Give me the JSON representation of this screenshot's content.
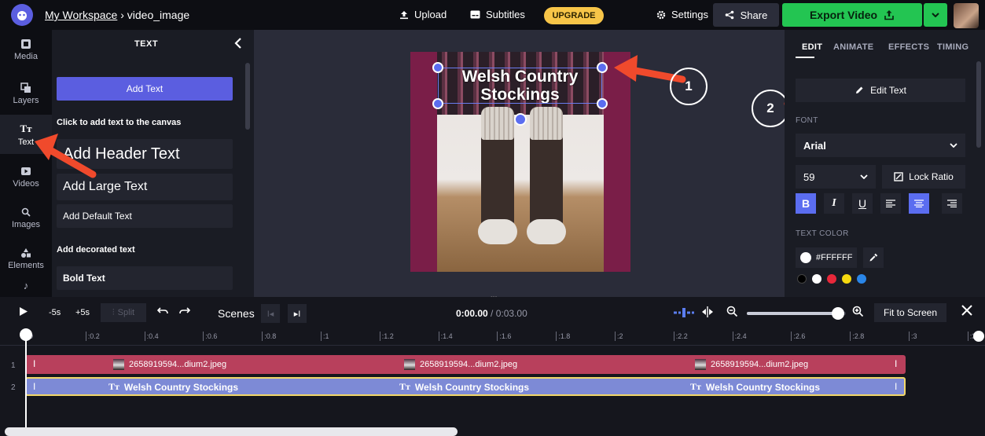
{
  "header": {
    "workspace": "My Workspace",
    "separator": "›",
    "project": "video_image",
    "upload": "Upload",
    "subtitles": "Subtitles",
    "upgrade": "UPGRADE",
    "settings": "Settings",
    "share": "Share",
    "export": "Export Video"
  },
  "nav": {
    "items": [
      {
        "label": "Media"
      },
      {
        "label": "Layers"
      },
      {
        "label": "Text"
      },
      {
        "label": "Videos"
      },
      {
        "label": "Images"
      },
      {
        "label": "Elements"
      }
    ]
  },
  "text_panel": {
    "title": "TEXT",
    "add_text": "Add Text",
    "hint": "Click to add text to the canvas",
    "header_text": "Add Header Text",
    "large_text": "Add Large Text",
    "default_text": "Add Default Text",
    "decorated_label": "Add decorated text",
    "bold_text": "Bold Text"
  },
  "canvas": {
    "text_line1": "Welsh Country",
    "text_line2": "Stockings",
    "annotation_1": "1",
    "annotation_2": "2"
  },
  "right_panel": {
    "tabs": [
      "EDIT",
      "ANIMATE",
      "EFFECTS",
      "TIMING"
    ],
    "edit_text": "Edit Text",
    "font_label": "FONT",
    "font_value": "Arial",
    "size_value": "59",
    "lock_ratio": "Lock Ratio",
    "text_color_label": "TEXT COLOR",
    "text_color_value": "#FFFFFF",
    "swatches": [
      "#000000",
      "#ffffff",
      "#e8283a",
      "#f5d90f",
      "#2a86e8"
    ]
  },
  "timeline": {
    "minus5": "-5s",
    "plus5": "+5s",
    "split": "Split",
    "scenes": "Scenes",
    "current_time": "0:00.00",
    "total_time": "/ 0:03.00",
    "fit_to_screen": "Fit to Screen",
    "zoom_level": 0.92,
    "ruler": [
      "0",
      ":0.2",
      ":0.4",
      ":0.6",
      ":0.8",
      ":1",
      ":1.2",
      ":1.4",
      ":1.6",
      ":1.8",
      ":2",
      ":2.2",
      ":2.4",
      ":2.6",
      ":2.8",
      ":3",
      ":3"
    ],
    "tracks": [
      {
        "num": "1",
        "clip": "2658919594...dium2.jpeg",
        "color": "#b8405c"
      },
      {
        "num": "2",
        "clip": "Welsh Country Stockings",
        "color": "#7d8ad6"
      }
    ]
  }
}
